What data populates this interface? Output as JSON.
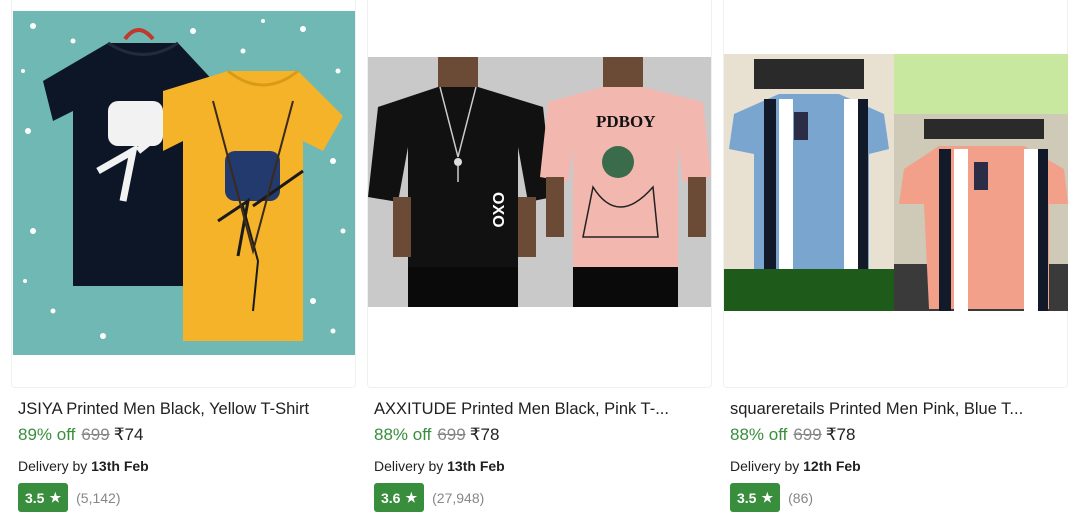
{
  "products": [
    {
      "title": "JSIYA Printed Men Black, Yellow T-Shirt",
      "discount": "89% off",
      "mrp": "699",
      "price": "₹74",
      "delivery_prefix": "Delivery by",
      "delivery_date": "13th Feb",
      "rating": "3.5",
      "rating_count": "(5,142)"
    },
    {
      "title": "AXXITUDE Printed Men Black, Pink T-...",
      "discount": "88% off",
      "mrp": "699",
      "price": "₹78",
      "delivery_prefix": "Delivery by",
      "delivery_date": "13th Feb",
      "rating": "3.6",
      "rating_count": "(27,948)",
      "image_text": {
        "shirt_left": "OXO",
        "shirt_right": "PDBOY"
      }
    },
    {
      "title": "squareretails Printed Men Pink, Blue T...",
      "discount": "88% off",
      "mrp": "699",
      "price": "₹78",
      "delivery_prefix": "Delivery by",
      "delivery_date": "12th Feb",
      "rating": "3.5",
      "rating_count": "(86)"
    }
  ],
  "icons": {
    "rating": "star-icon"
  },
  "colors": {
    "discount": "#388e3c",
    "rating_badge": "#388e3c",
    "muted": "#878787"
  }
}
